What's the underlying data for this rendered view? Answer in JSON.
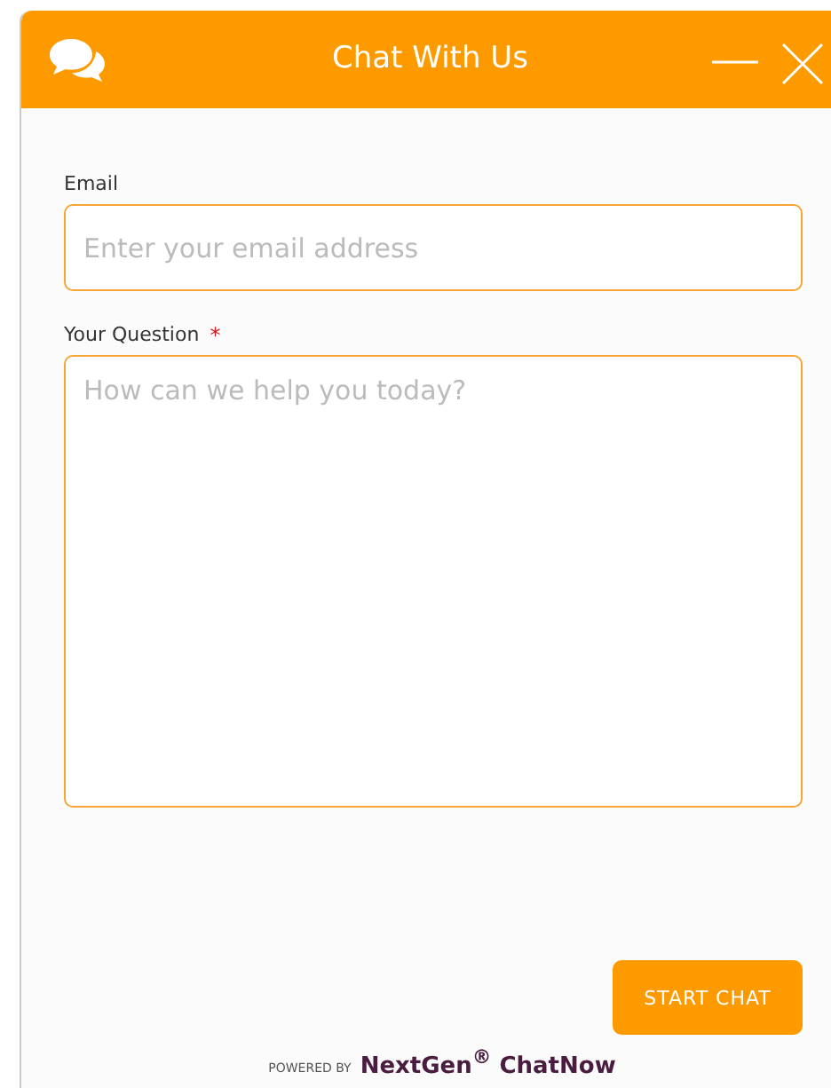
{
  "header": {
    "title": "Chat With Us"
  },
  "fields": [
    {
      "kind": "input",
      "label": "Email",
      "placeholder": "Enter your email address"
    },
    {
      "kind": "textarea",
      "label": "Your Question",
      "required_mark": "*",
      "placeholder": "How can we help you today?"
    }
  ],
  "button": "START CHAT",
  "footer": {
    "powered": "POWERED BY",
    "brand": "NextGen$^{®}$ ChatNow"
  }
}
